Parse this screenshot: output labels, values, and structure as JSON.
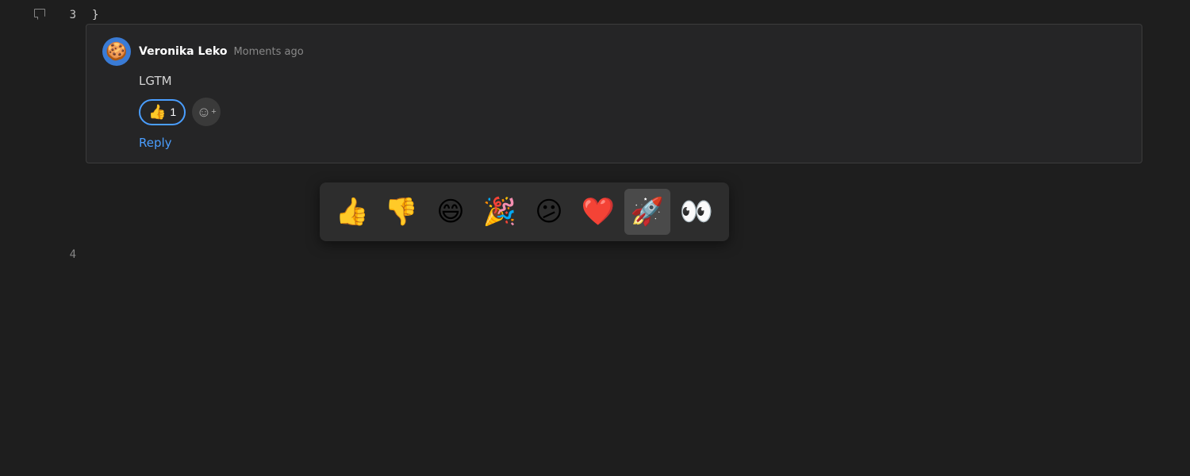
{
  "editor": {
    "line_numbers": [
      {
        "number": "3",
        "active": true
      },
      {
        "number": "4",
        "active": false
      }
    ],
    "code_line": "}"
  },
  "comment": {
    "author": "Veronika Leko",
    "time": "Moments ago",
    "body": "LGTM",
    "avatar_emoji": "🍪",
    "reactions": [
      {
        "emoji": "👍",
        "count": "1",
        "active": true
      }
    ],
    "add_reaction_label": "☺+",
    "reply_label": "Reply"
  },
  "emoji_picker": {
    "emojis": [
      {
        "emoji": "👍",
        "name": "thumbs-up"
      },
      {
        "emoji": "👎",
        "name": "thumbs-down"
      },
      {
        "emoji": "😄",
        "name": "grinning-face"
      },
      {
        "emoji": "🎉",
        "name": "party-popper"
      },
      {
        "emoji": "😕",
        "name": "confused-face"
      },
      {
        "emoji": "❤️",
        "name": "red-heart"
      },
      {
        "emoji": "🚀",
        "name": "rocket"
      },
      {
        "emoji": "👀",
        "name": "eyes"
      }
    ]
  }
}
